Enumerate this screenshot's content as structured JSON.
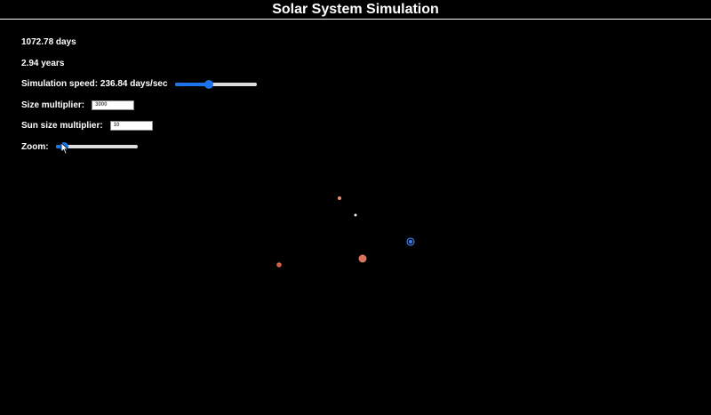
{
  "header": {
    "title": "Solar System Simulation"
  },
  "stats": {
    "days": "1072.78 days",
    "years": "2.94 years"
  },
  "controls": {
    "speed_label": "Simulation speed: 236.84 days/sec",
    "speed_fraction": 0.42,
    "size_label": "Size multiplier:",
    "size_value": "3000",
    "sun_size_label": "Sun size multiplier:",
    "sun_size_value": "10",
    "zoom_label": "Zoom:",
    "zoom_fraction": 0.1
  },
  "bodies": [
    {
      "name": "sun",
      "color": "#d9745c"
    },
    {
      "name": "mercury",
      "color": "#e8e8e8"
    },
    {
      "name": "venus",
      "color": "#e8926a"
    },
    {
      "name": "earth",
      "color": "#3a78e8"
    },
    {
      "name": "mars",
      "color": "#d8604a"
    }
  ],
  "icons": {
    "cursor": "arrow-cursor-icon"
  }
}
